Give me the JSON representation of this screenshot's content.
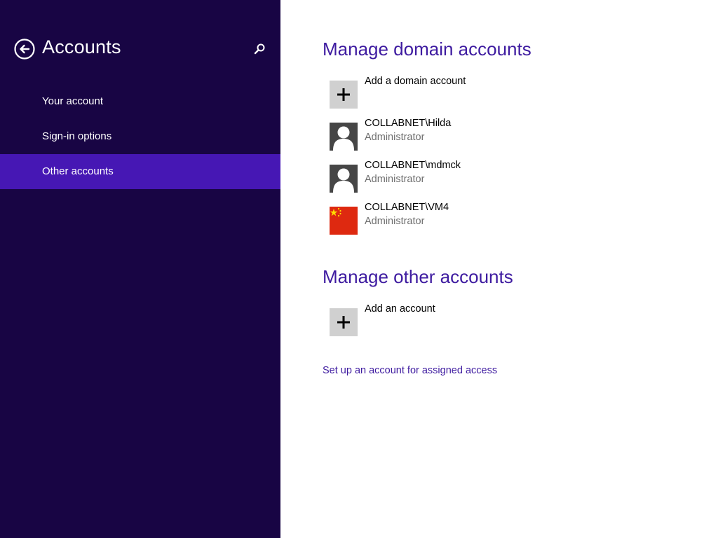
{
  "header": {
    "title": "Accounts",
    "back_icon": "back-arrow-icon",
    "search_icon": "search-icon"
  },
  "nav": {
    "items": [
      {
        "label": "Your account"
      },
      {
        "label": "Sign-in options"
      },
      {
        "label": "Other accounts",
        "selected": true
      }
    ]
  },
  "domain_section": {
    "title": "Manage domain accounts",
    "add_label": "Add a domain account",
    "accounts": [
      {
        "name": "COLLABNET\\Hilda",
        "role": "Administrator",
        "picture": "user-silhouette-icon"
      },
      {
        "name": "COLLABNET\\mdmck",
        "role": "Administrator",
        "picture": "user-silhouette-icon"
      },
      {
        "name": "COLLABNET\\VM4",
        "role": "Administrator",
        "picture": "flag-picture"
      }
    ]
  },
  "other_section": {
    "title": "Manage other accounts",
    "add_label": "Add an account"
  },
  "assigned_access_link": "Set up an account for assigned access",
  "colors": {
    "left_pane_bg": "#180544",
    "selected_item_bg": "#4617b4",
    "accent_text": "#3e1ba0",
    "tile_gray": "#d0d0d0",
    "avatar_bg": "#464646"
  }
}
